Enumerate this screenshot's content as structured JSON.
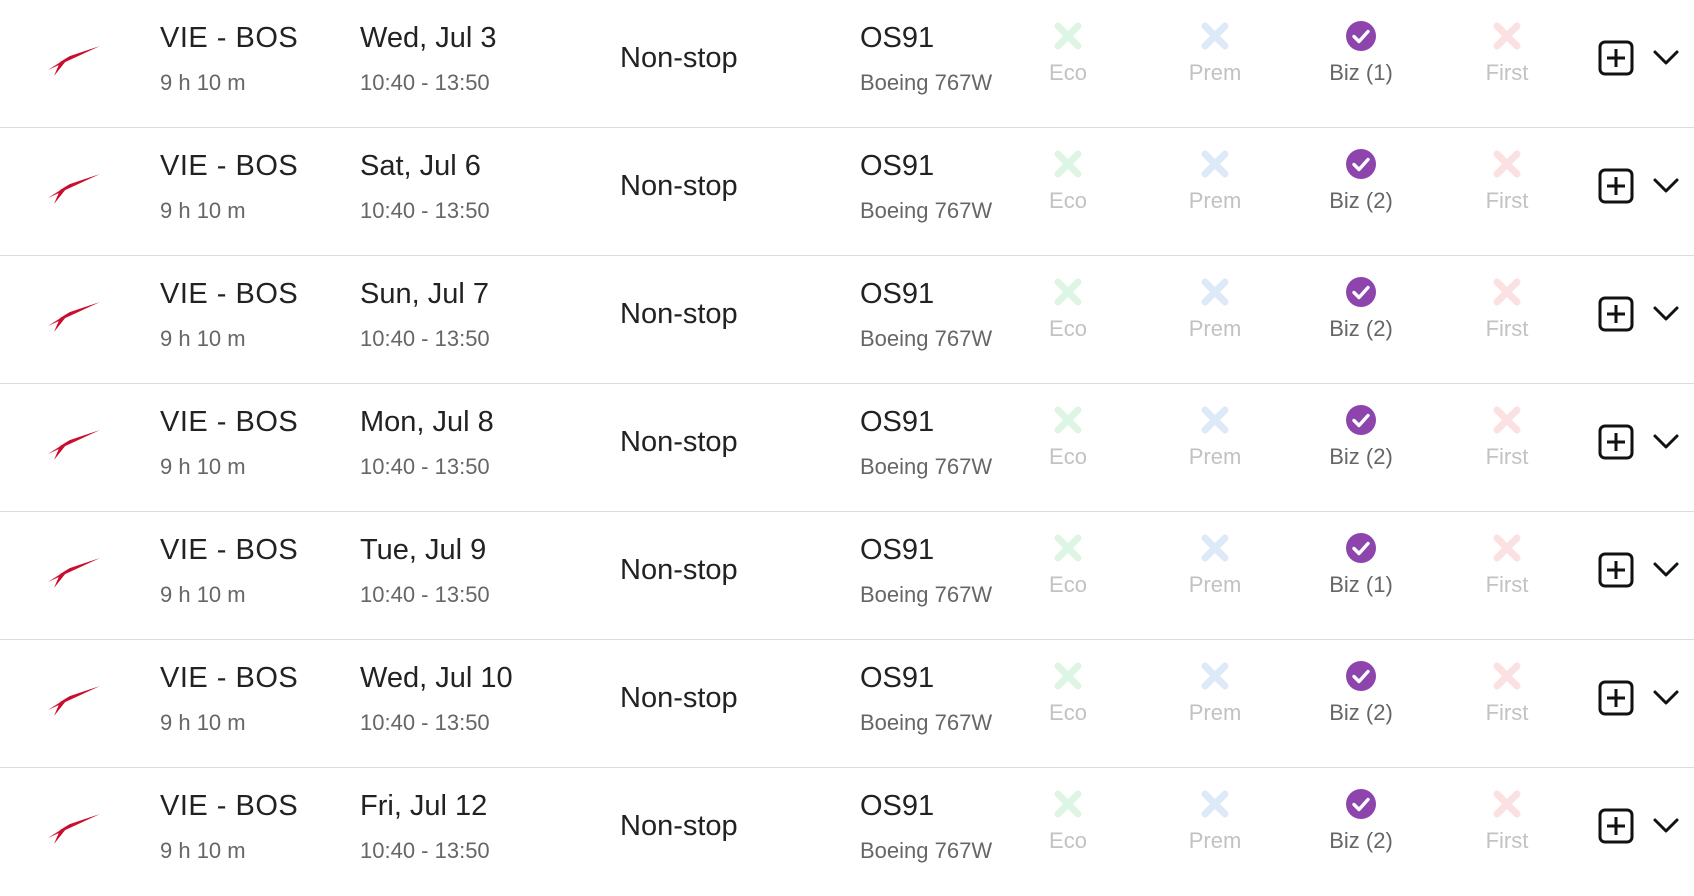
{
  "colors": {
    "airline_red": "#c8102e",
    "eco_unavailable": "#def5e4",
    "prem_unavailable": "#dde9f6",
    "biz_available": "#8e44ad",
    "first_unavailable": "#fbe1e1"
  },
  "flights": [
    {
      "airline_icon": "austrian-airlines-logo",
      "route": "VIE - BOS",
      "duration": "9 h 10 m",
      "date": "Wed, Jul 3",
      "times": "10:40 - 13:50",
      "stops": "Non-stop",
      "flight_number": "OS91",
      "aircraft": "Boeing 767W",
      "cabins": {
        "eco": {
          "label": "Eco",
          "available": false
        },
        "prem": {
          "label": "Prem",
          "available": false
        },
        "biz": {
          "label": "Biz (1)",
          "available": true
        },
        "first": {
          "label": "First",
          "available": false
        }
      }
    },
    {
      "airline_icon": "austrian-airlines-logo",
      "route": "VIE - BOS",
      "duration": "9 h 10 m",
      "date": "Sat, Jul 6",
      "times": "10:40 - 13:50",
      "stops": "Non-stop",
      "flight_number": "OS91",
      "aircraft": "Boeing 767W",
      "cabins": {
        "eco": {
          "label": "Eco",
          "available": false
        },
        "prem": {
          "label": "Prem",
          "available": false
        },
        "biz": {
          "label": "Biz (2)",
          "available": true
        },
        "first": {
          "label": "First",
          "available": false
        }
      }
    },
    {
      "airline_icon": "austrian-airlines-logo",
      "route": "VIE - BOS",
      "duration": "9 h 10 m",
      "date": "Sun, Jul 7",
      "times": "10:40 - 13:50",
      "stops": "Non-stop",
      "flight_number": "OS91",
      "aircraft": "Boeing 767W",
      "cabins": {
        "eco": {
          "label": "Eco",
          "available": false
        },
        "prem": {
          "label": "Prem",
          "available": false
        },
        "biz": {
          "label": "Biz (2)",
          "available": true
        },
        "first": {
          "label": "First",
          "available": false
        }
      }
    },
    {
      "airline_icon": "austrian-airlines-logo",
      "route": "VIE - BOS",
      "duration": "9 h 10 m",
      "date": "Mon, Jul 8",
      "times": "10:40 - 13:50",
      "stops": "Non-stop",
      "flight_number": "OS91",
      "aircraft": "Boeing 767W",
      "cabins": {
        "eco": {
          "label": "Eco",
          "available": false
        },
        "prem": {
          "label": "Prem",
          "available": false
        },
        "biz": {
          "label": "Biz (2)",
          "available": true
        },
        "first": {
          "label": "First",
          "available": false
        }
      }
    },
    {
      "airline_icon": "austrian-airlines-logo",
      "route": "VIE - BOS",
      "duration": "9 h 10 m",
      "date": "Tue, Jul 9",
      "times": "10:40 - 13:50",
      "stops": "Non-stop",
      "flight_number": "OS91",
      "aircraft": "Boeing 767W",
      "cabins": {
        "eco": {
          "label": "Eco",
          "available": false
        },
        "prem": {
          "label": "Prem",
          "available": false
        },
        "biz": {
          "label": "Biz (1)",
          "available": true
        },
        "first": {
          "label": "First",
          "available": false
        }
      }
    },
    {
      "airline_icon": "austrian-airlines-logo",
      "route": "VIE - BOS",
      "duration": "9 h 10 m",
      "date": "Wed, Jul 10",
      "times": "10:40 - 13:50",
      "stops": "Non-stop",
      "flight_number": "OS91",
      "aircraft": "Boeing 767W",
      "cabins": {
        "eco": {
          "label": "Eco",
          "available": false
        },
        "prem": {
          "label": "Prem",
          "available": false
        },
        "biz": {
          "label": "Biz (2)",
          "available": true
        },
        "first": {
          "label": "First",
          "available": false
        }
      }
    },
    {
      "airline_icon": "austrian-airlines-logo",
      "route": "VIE - BOS",
      "duration": "9 h 10 m",
      "date": "Fri, Jul 12",
      "times": "10:40 - 13:50",
      "stops": "Non-stop",
      "flight_number": "OS91",
      "aircraft": "Boeing 767W",
      "cabins": {
        "eco": {
          "label": "Eco",
          "available": false
        },
        "prem": {
          "label": "Prem",
          "available": false
        },
        "biz": {
          "label": "Biz (2)",
          "available": true
        },
        "first": {
          "label": "First",
          "available": false
        }
      }
    }
  ]
}
